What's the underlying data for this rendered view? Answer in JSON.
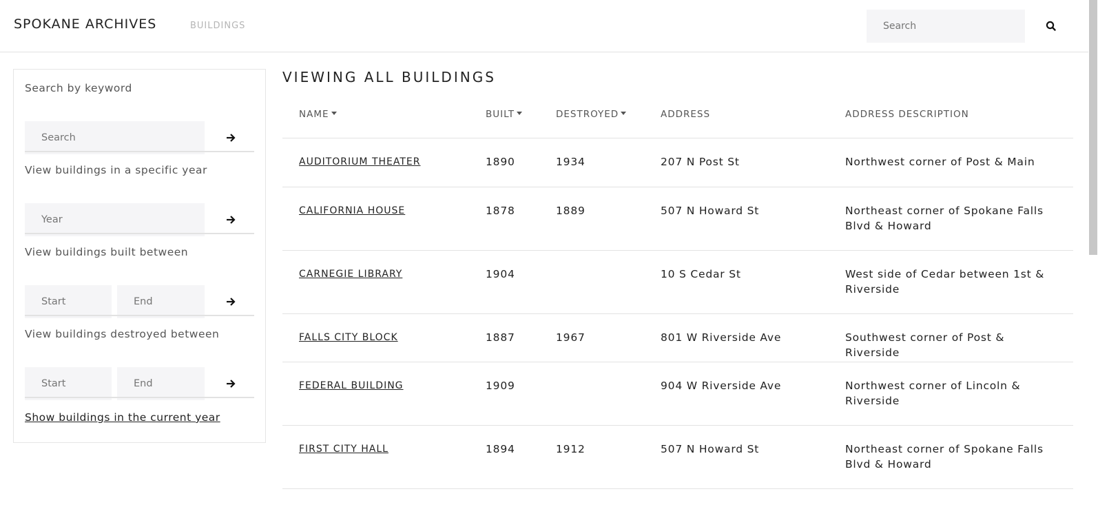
{
  "header": {
    "brand": "SPOKANE ARCHIVES",
    "nav_buildings": "BUILDINGS",
    "search_placeholder": "Search",
    "search_icon": "search-icon"
  },
  "sidebar": {
    "keyword_label": "Search by keyword",
    "keyword_placeholder": "Search",
    "year_label": "View buildings in a specific year",
    "year_placeholder": "Year",
    "built_label": "View buildings built between",
    "built_start_placeholder": "Start",
    "built_end_placeholder": "End",
    "destroyed_label": "View buildings destroyed between",
    "destroyed_start_placeholder": "Start",
    "destroyed_end_placeholder": "End",
    "current_year_link": "Show buildings in the current year",
    "go_icon": "arrow-right-icon"
  },
  "main": {
    "title": "VIEWING ALL BUILDINGS",
    "columns": {
      "name": "NAME",
      "built": "BUILT",
      "destroyed": "DESTROYED",
      "address": "ADDRESS",
      "description": "ADDRESS DESCRIPTION"
    },
    "rows": [
      {
        "name": "AUDITORIUM THEATER",
        "built": "1890",
        "destroyed": "1934",
        "address": "207 N Post St",
        "description": "Northwest corner of Post & Main"
      },
      {
        "name": "CALIFORNIA HOUSE",
        "built": "1878",
        "destroyed": "1889",
        "address": "507 N Howard St",
        "description": "Northeast corner of Spokane Falls Blvd & Howard"
      },
      {
        "name": "CARNEGIE LIBRARY",
        "built": "1904",
        "destroyed": "",
        "address": "10 S Cedar St",
        "description": "West side of Cedar between 1st & Riverside"
      },
      {
        "name": "FALLS CITY BLOCK",
        "built": "1887",
        "destroyed": "1967",
        "address": "801 W Riverside Ave",
        "description": "Southwest corner of Post & Riverside"
      },
      {
        "name": "FEDERAL BUILDING",
        "built": "1909",
        "destroyed": "",
        "address": "904 W Riverside Ave",
        "description": "Northwest corner of Lincoln & Riverside"
      },
      {
        "name": "FIRST CITY HALL",
        "built": "1894",
        "destroyed": "1912",
        "address": "507 N Howard St",
        "description": "Northeast corner of Spokane Falls Blvd & Howard"
      }
    ]
  }
}
